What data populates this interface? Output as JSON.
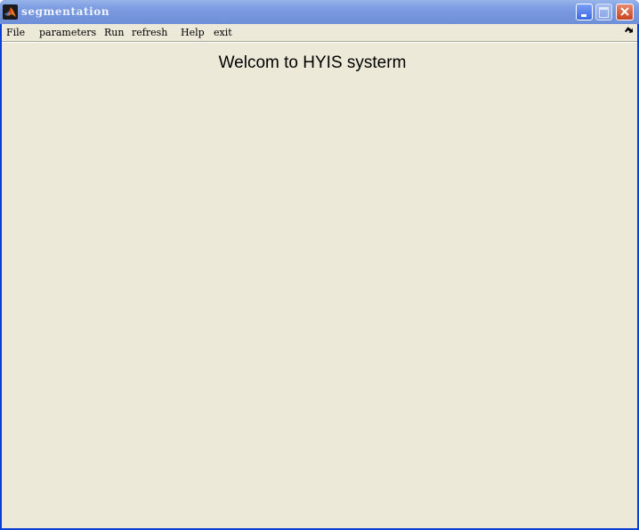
{
  "window": {
    "title": "segmentation",
    "icon": "matlab-logo-icon"
  },
  "controls": {
    "minimize_icon": "minimize-icon",
    "maximize_icon": "maximize-icon",
    "close_icon": "close-icon"
  },
  "menubar": {
    "items": [
      "File",
      "parameters",
      "Run",
      "refresh",
      "Help",
      "exit"
    ],
    "overflow_icon": "dock-arrow-icon"
  },
  "main": {
    "welcome_text": "Welcom to HYIS systerm"
  },
  "colors": {
    "titlebar": "#7a99de",
    "client_background": "#ece9d8",
    "close_button": "#d05a34"
  }
}
